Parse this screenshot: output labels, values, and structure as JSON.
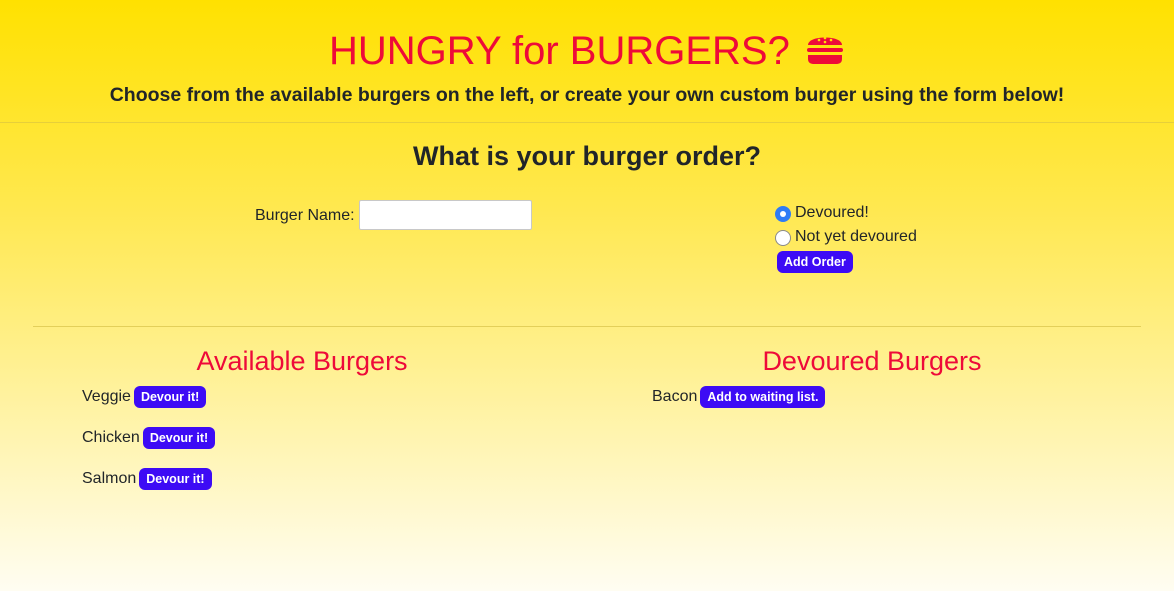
{
  "header": {
    "title": "HUNGRY for BURGERS?",
    "icon": "burger-icon",
    "subtitle": "Choose from the available burgers on the left, or create your own custom burger using the form below!"
  },
  "order_form": {
    "heading": "What is your burger order?",
    "name_label": "Burger Name:",
    "name_value": "",
    "radios": [
      {
        "label": "Devoured!",
        "checked": true
      },
      {
        "label": "Not yet devoured",
        "checked": false
      }
    ],
    "submit_label": "Add Order"
  },
  "available": {
    "heading": "Available Burgers",
    "items": [
      {
        "name": "Veggie",
        "button": "Devour it!"
      },
      {
        "name": "Chicken",
        "button": "Devour it!"
      },
      {
        "name": "Salmon",
        "button": "Devour it!"
      }
    ]
  },
  "devoured": {
    "heading": "Devoured Burgers",
    "items": [
      {
        "name": "Bacon",
        "button": "Add to waiting list."
      }
    ]
  },
  "colors": {
    "accent_red": "#ee0a39",
    "button_blue": "#3d0bf5",
    "background_yellow": "#ffe100"
  }
}
